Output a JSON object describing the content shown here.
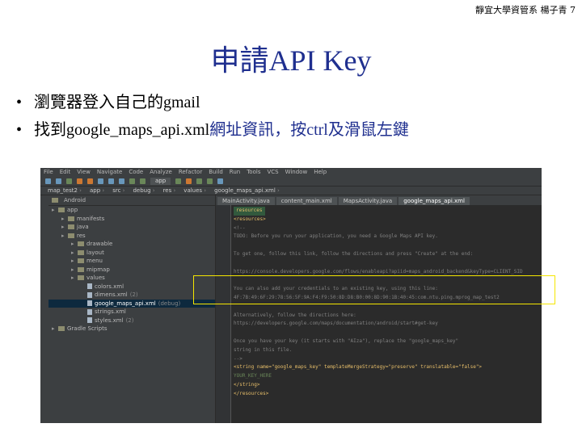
{
  "header": {
    "course": "靜宜大學資管系 楊子青",
    "page": "7"
  },
  "slide": {
    "title": "申請API Key",
    "bullet1": "瀏覽器登入自己的gmail",
    "bullet2_a": "找到google_maps_api.xml",
    "bullet2_b": "網址資訊，按ctrl及滑鼠左鍵"
  },
  "ide": {
    "menu": [
      "File",
      "Edit",
      "View",
      "Navigate",
      "Code",
      "Analyze",
      "Refactor",
      "Build",
      "Run",
      "Tools",
      "VCS",
      "Window",
      "Help"
    ],
    "run_config": "app",
    "breadcrumbs": [
      "map_test2",
      "app",
      "src",
      "debug",
      "res",
      "values",
      "google_maps_api.xml"
    ],
    "project_view": "Android",
    "tree": [
      {
        "label": "app",
        "indent": 0,
        "kind": "folder"
      },
      {
        "label": "manifests",
        "indent": 1,
        "kind": "folder"
      },
      {
        "label": "java",
        "indent": 1,
        "kind": "folder"
      },
      {
        "label": "res",
        "indent": 1,
        "kind": "folder"
      },
      {
        "label": "drawable",
        "indent": 2,
        "kind": "folder"
      },
      {
        "label": "layout",
        "indent": 2,
        "kind": "folder"
      },
      {
        "label": "menu",
        "indent": 2,
        "kind": "folder"
      },
      {
        "label": "mipmap",
        "indent": 2,
        "kind": "folder"
      },
      {
        "label": "values",
        "indent": 2,
        "kind": "folder"
      },
      {
        "label": "colors.xml",
        "indent": 3,
        "kind": "file"
      },
      {
        "label": "dimens.xml",
        "suffix": "(2)",
        "indent": 3,
        "kind": "file"
      },
      {
        "label": "google_maps_api.xml",
        "suffix": "(debug)",
        "indent": 3,
        "kind": "file",
        "selected": true
      },
      {
        "label": "strings.xml",
        "indent": 3,
        "kind": "file"
      },
      {
        "label": "styles.xml",
        "suffix": "(2)",
        "indent": 3,
        "kind": "file"
      },
      {
        "label": "Gradle Scripts",
        "indent": 0,
        "kind": "folder"
      }
    ],
    "tabs": [
      "MainActivity.java",
      "content_main.xml",
      "MapsActivity.java",
      "google_maps_api.xml"
    ],
    "code": [
      {
        "text": "resources",
        "cls": "hdr"
      },
      {
        "text": "<resources>",
        "cls": "tag"
      },
      {
        "text": "  <!--",
        "cls": "comment"
      },
      {
        "text": "  TODO: Before you run your application, you need a Google Maps API key.",
        "cls": "comment"
      },
      {
        "text": "",
        "cls": ""
      },
      {
        "text": "  To get one, follow this link, follow the directions and press \"Create\" at the end:",
        "cls": "comment"
      },
      {
        "text": "",
        "cls": ""
      },
      {
        "text": "  https://console.developers.google.com/flows/enableapi?apiid=maps_android_backend&keyType=CLIENT_SID",
        "cls": "comment"
      },
      {
        "text": "",
        "cls": ""
      },
      {
        "text": "  You can also add your credentials to an existing key, using this line:",
        "cls": "comment"
      },
      {
        "text": "  4F:7B:49:6F:29:78:56:5F:9A:F4:F9:50:8D:D8:B0:00:8D:90:1B:40:45:com.ntu.ping.mprog_map_test2",
        "cls": "comment"
      },
      {
        "text": "",
        "cls": ""
      },
      {
        "text": "  Alternatively, follow the directions here:",
        "cls": "comment"
      },
      {
        "text": "  https://developers.google.com/maps/documentation/android/start#get-key",
        "cls": "comment"
      },
      {
        "text": "",
        "cls": ""
      },
      {
        "text": "  Once you have your key (it starts with \"AIza\"), replace the \"google_maps_key\"",
        "cls": "comment"
      },
      {
        "text": "  string in this file.",
        "cls": "comment"
      },
      {
        "text": "  -->",
        "cls": "comment"
      },
      {
        "text": "  <string name=\"google_maps_key\" templateMergeStrategy=\"preserve\" translatable=\"false\">",
        "cls": "tag"
      },
      {
        "text": "      YOUR_KEY_HERE",
        "cls": "str"
      },
      {
        "text": "  </string>",
        "cls": "tag"
      },
      {
        "text": "</resources>",
        "cls": "tag"
      }
    ],
    "colors": {
      "highlight": "#f5e600",
      "title": "#1f2f8f"
    }
  }
}
